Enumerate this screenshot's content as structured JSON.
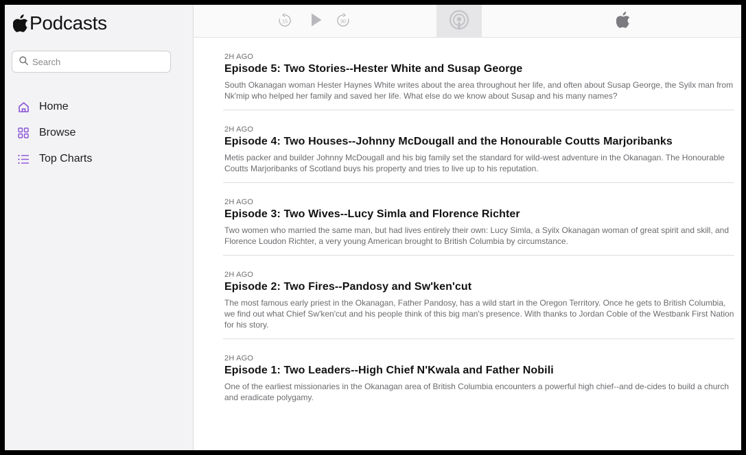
{
  "app": {
    "name": "Podcasts"
  },
  "search": {
    "placeholder": "Search"
  },
  "sidebar": {
    "items": [
      {
        "label": "Home",
        "icon": "home-icon"
      },
      {
        "label": "Browse",
        "icon": "grid-icon"
      },
      {
        "label": "Top Charts",
        "icon": "list-icon"
      }
    ]
  },
  "player": {
    "skip_back_seconds": "15",
    "skip_forward_seconds": "30"
  },
  "colors": {
    "accent": "#8a4fd6",
    "sidebar_bg": "#f3f3f5"
  },
  "episodes": [
    {
      "date": "2H AGO",
      "title": "Episode 5: Two Stories--Hester White and Susap George",
      "description": "South Okanagan woman Hester Haynes White writes about the area throughout her life, and often about Susap George, the Syilx man from Nk'mip who helped her family and saved her life. What else do we know about Susap and his many names?"
    },
    {
      "date": "2H AGO",
      "title": "Episode 4: Two Houses--Johnny McDougall and the Honourable Coutts Marjoribanks",
      "description": "Metis packer and builder Johnny McDougall and his big family set the standard for wild-west adventure in the Okanagan. The Honourable Coutts Marjoribanks of Scotland buys his property and tries to live up to his reputation."
    },
    {
      "date": "2H AGO",
      "title": "Episode 3: Two Wives--Lucy Simla and Florence Richter",
      "description": "Two women who married the same man, but had lives entirely their own: Lucy Simla, a Syilx Okanagan woman of great spirit and skill, and Florence Loudon Richter, a very young American brought to British Columbia by circumstance."
    },
    {
      "date": "2H AGO",
      "title": "Episode 2: Two Fires--Pandosy and Sw'ken'cut",
      "description": "The most famous early priest in the Okanagan, Father Pandosy, has a wild start in the Oregon Territory. Once he gets to British Columbia, we find out what Chief Sw'ken'cut and his people think of this big man's presence. With thanks to Jordan Coble of the Westbank First Nation for his story."
    },
    {
      "date": "2H AGO",
      "title": "Episode 1: Two Leaders--High Chief N'Kwala and Father Nobili",
      "description": "One of the earliest missionaries in the Okanagan area of British Columbia encounters a powerful high chief--and de-cides to build a church and eradicate polygamy."
    }
  ]
}
